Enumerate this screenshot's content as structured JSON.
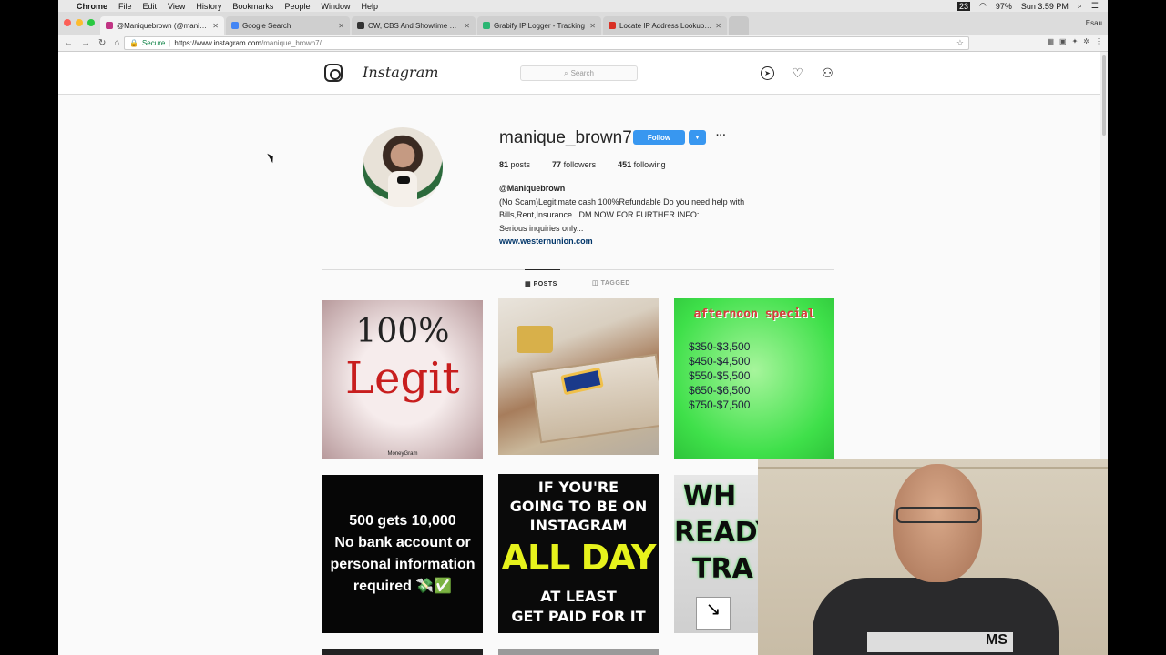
{
  "menubar": {
    "app": "Chrome",
    "menus": [
      "File",
      "Edit",
      "View",
      "History",
      "Bookmarks",
      "People",
      "Window",
      "Help"
    ],
    "battery": "97%",
    "clock": "Sun 3:59 PM",
    "badge": "23"
  },
  "tabs": [
    {
      "title": "@Maniquebrown (@manique_b",
      "color": "#c13584"
    },
    {
      "title": "Google Search",
      "color": "#4285f4"
    },
    {
      "title": "CW, CBS And Showtime 2012",
      "color": "#333333"
    },
    {
      "title": "Grabify IP Logger - Tracking",
      "color": "#2bb673"
    },
    {
      "title": "Locate IP Address Lookup Sho",
      "color": "#d93025"
    }
  ],
  "browser_profile": "Esau",
  "address": {
    "secure_label": "Secure",
    "url_domain": "https://www.instagram.com",
    "url_path": "/manique_brown7/"
  },
  "instagram": {
    "wordmark": "Instagram",
    "search_placeholder": "Search"
  },
  "profile": {
    "username": "manique_brown7",
    "follow_label": "Follow",
    "more_label": "···",
    "stats": {
      "posts_count": "81",
      "posts_label": "posts",
      "followers_count": "77",
      "followers_label": "followers",
      "following_count": "451",
      "following_label": "following"
    },
    "bio_name": "@Maniquebrown",
    "bio_line1": "(No Scam)Legitimate cash 100%Refundable Do you need help with",
    "bio_line2": "Bills,Rent,Insurance...DM NOW FOR FURTHER INFO:",
    "bio_line3": "Serious inquiries only...",
    "bio_link": "www.westernunion.com"
  },
  "profile_tabs": {
    "posts": "POSTS",
    "tagged": "TAGGED"
  },
  "posts": {
    "p1": {
      "line1": "100%",
      "line2": "Legit",
      "brand": "MoneyGram"
    },
    "p3": {
      "heading": "afternoon special",
      "prices": [
        "$350-$3,500",
        "$450-$4,500",
        "$550-$5,500",
        "$650-$6,500",
        "$750-$7,500"
      ]
    },
    "p4": {
      "line1": "500 gets 10,000",
      "line2": "No bank account or",
      "line3": "personal information",
      "line4": "required 💸✅"
    },
    "p5": {
      "line1": "IF YOU'RE",
      "line2": "GOING TO BE ON",
      "line3": "INSTAGRAM",
      "line4": "ALL DAY",
      "line5": "AT LEAST",
      "line6": "GET PAID FOR IT"
    },
    "p6": {
      "line1": "WH",
      "line2": "READY",
      "line3": "TRA"
    }
  },
  "webcam": {
    "shirt_text": "MS"
  }
}
